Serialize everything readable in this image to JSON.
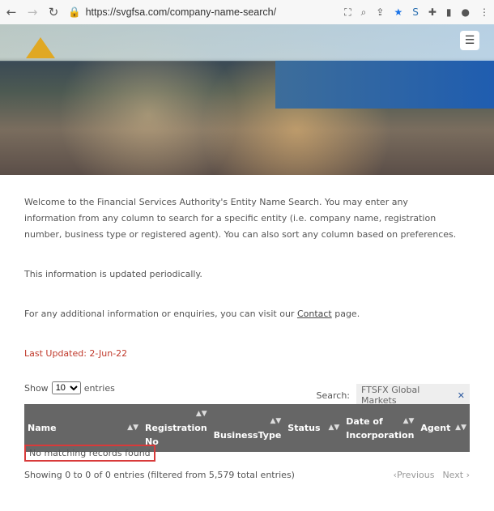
{
  "browser": {
    "url": "https://svgfsa.com/company-name-search/"
  },
  "intro": {
    "p1": "Welcome to the Financial Services Authority's Entity Name Search. You may enter any information from any column to search for a specific entity (i.e. company name, registration number, business type or registered agent). You can also sort any column based on preferences.",
    "p2": "This information is updated periodically.",
    "p3_pre": "For any additional information or enquiries, you can visit our ",
    "p3_link": "Contact",
    "p3_post": " page.",
    "last_updated": "Last Updated:  2-Jun-22"
  },
  "table_controls": {
    "show": "Show",
    "length": "10",
    "entries": "entries",
    "search_label": "Search:",
    "search_value": "FTSFX Global Markets"
  },
  "table": {
    "columns": [
      "Name",
      "Registration No",
      "BusinessType",
      "Status",
      "Date of Incorporation",
      "Agent"
    ],
    "empty": "No matching records found"
  },
  "footer": {
    "info": "Showing 0 to 0 of 0 entries (filtered from 5,579 total entries)",
    "previous": "Previous",
    "next": "Next"
  }
}
